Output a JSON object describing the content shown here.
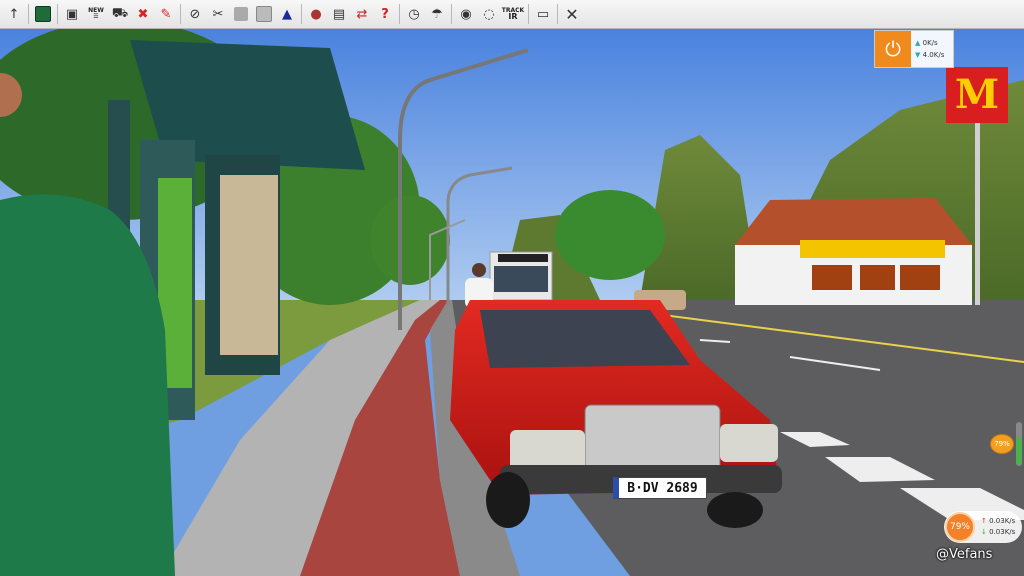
{
  "toolbar": {
    "icons": [
      "arrow-up-icon",
      "map-icon",
      "save-icon",
      "new-timetable-icon",
      "bus-icon",
      "remove-bus-icon",
      "marker-icon",
      "route-icon",
      "tools-icon",
      "gray-block-icon",
      "copy-icon",
      "bell-icon",
      "driver-icon",
      "notepad-icon",
      "swap-icon",
      "help-icon",
      "clock-icon",
      "weather-icon",
      "camera-icon",
      "mouse-icon",
      "track-icon",
      "screenshot-icon",
      "close-icon"
    ],
    "new_label": "NEW",
    "track_label_top": "TRACK",
    "track_label_bottom": "IR",
    "close_symbol": "✕"
  },
  "network_widget": {
    "upload": "0K/s",
    "download": "4.0K/s",
    "accent": "#f08a1c"
  },
  "mini_widget": {
    "percent": "79%",
    "upload": "0.03K/s",
    "download": "0.03K/s"
  },
  "side_indicator": {
    "percent": "79%"
  },
  "scene": {
    "license_plate": "B·DV 2689",
    "restaurant_sign": "M",
    "watermark": "@Vefans"
  }
}
